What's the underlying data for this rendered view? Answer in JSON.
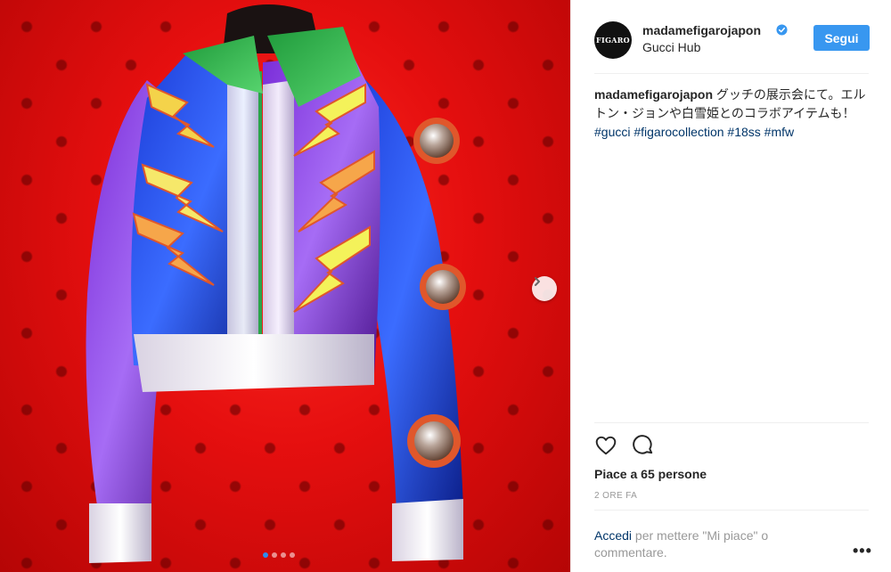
{
  "post": {
    "username": "madamefigarojapon",
    "location": "Gucci Hub",
    "avatar_text": "FIGARO",
    "follow_label": "Segui",
    "caption": {
      "author": "madamefigarojapon",
      "text": " グッチの展示会にて。エルトン・ジョンや白雪姫とのコラボアイテムも！",
      "tags": [
        "#gucci",
        "#figarocollection",
        "#18ss",
        "#mfw"
      ]
    },
    "likes": "Piace a 65 persone",
    "timestamp": "2 ORE FA",
    "login": {
      "link": "Accedi",
      "rest": " per mettere \"Mi piace\" o commentare."
    },
    "more_label": "•••"
  },
  "carousel": {
    "dots": 4,
    "active_index": 0
  },
  "icons": {
    "verified": "verified-badge-icon",
    "like": "heart-icon",
    "comment": "comment-icon",
    "next": "chevron-right-icon",
    "more": "more-options-icon"
  },
  "colors": {
    "accent": "#3897f0",
    "link": "#003569",
    "muted": "#999999",
    "text": "#262626"
  }
}
